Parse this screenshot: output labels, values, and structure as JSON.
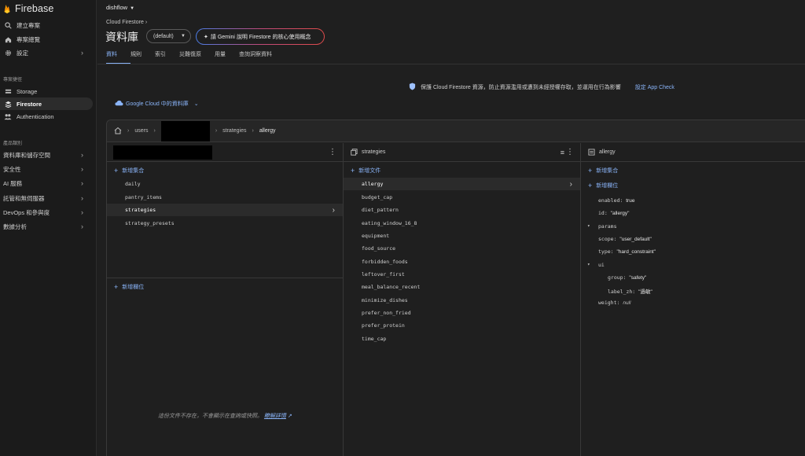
{
  "app": {
    "name": "Firebase"
  },
  "nav": {
    "items_top": [
      {
        "label": "建立專案"
      },
      {
        "label": "專案總覽"
      },
      {
        "label": "設定"
      }
    ],
    "section_label": "專案捷徑",
    "shortcuts": [
      {
        "label": "Storage"
      },
      {
        "label": "Firestore"
      },
      {
        "label": "Authentication"
      }
    ],
    "section2_label": "產品類別",
    "categories": [
      {
        "label": "資料庫和儲存空間"
      },
      {
        "label": "安全性"
      },
      {
        "label": "AI 服務"
      },
      {
        "label": "託管和無伺服器"
      },
      {
        "label": "DevOps 和參與度"
      },
      {
        "label": "數據分析"
      }
    ]
  },
  "header": {
    "project": "dishflow",
    "breadcrumb": "Cloud Firestore",
    "title": "資料庫",
    "database": "(default)",
    "gemini_label": "請 Gemini 說明 Firestore 的核心使用概念",
    "tabs": [
      "資料",
      "規則",
      "索引",
      "災難復原",
      "用量",
      "查詢洞察資料"
    ]
  },
  "banner": {
    "text": "保護 Cloud Firestore 資源，防止資源濫用或遭到未經授權存取，並運用在行為影響",
    "link": "設定 App Check"
  },
  "gcloud_label": "Google Cloud 中的資料庫",
  "path": {
    "users": "users",
    "strategies": "strategies",
    "current": "allergy"
  },
  "col1": {
    "add_collection": "新增集合",
    "collections": [
      "daily",
      "pantry_items",
      "strategies",
      "strategy_presets"
    ],
    "selected": "strategies",
    "add_field": "新增欄位",
    "empty_note": "這份文件不存在，不會顯示在查詢或快照。",
    "empty_link": "瞭解詳情"
  },
  "col2": {
    "title": "strategies",
    "add_document": "新增文件",
    "documents": [
      "allergy",
      "budget_cap",
      "diet_pattern",
      "eating_window_16_8",
      "equipment",
      "food_source",
      "forbidden_foods",
      "leftover_first",
      "meal_balance_recent",
      "minimize_dishes",
      "prefer_non_fried",
      "prefer_protein",
      "time_cap"
    ],
    "selected": "allergy"
  },
  "col3": {
    "title": "allergy",
    "add_collection": "新增集合",
    "add_field": "新增欄位",
    "fields": {
      "enabled_key": "enabled:",
      "enabled_val": "true",
      "id_key": "id:",
      "id_val": "\"allergy\"",
      "params_key": "params",
      "scope_key": "scope:",
      "scope_val": "\"user_default\"",
      "type_key": "type:",
      "type_val": "\"hard_constraint\"",
      "ui_key": "ui",
      "group_key": "group:",
      "group_val": "\"safety\"",
      "labelzh_key": "label_zh:",
      "labelzh_val": "\"過敏\"",
      "weight_key": "weight:",
      "weight_val": "null"
    }
  },
  "colors": {
    "accent": "#8ab4f8",
    "background": "#1f1f1f",
    "firebase_orange": "#f57c00"
  }
}
